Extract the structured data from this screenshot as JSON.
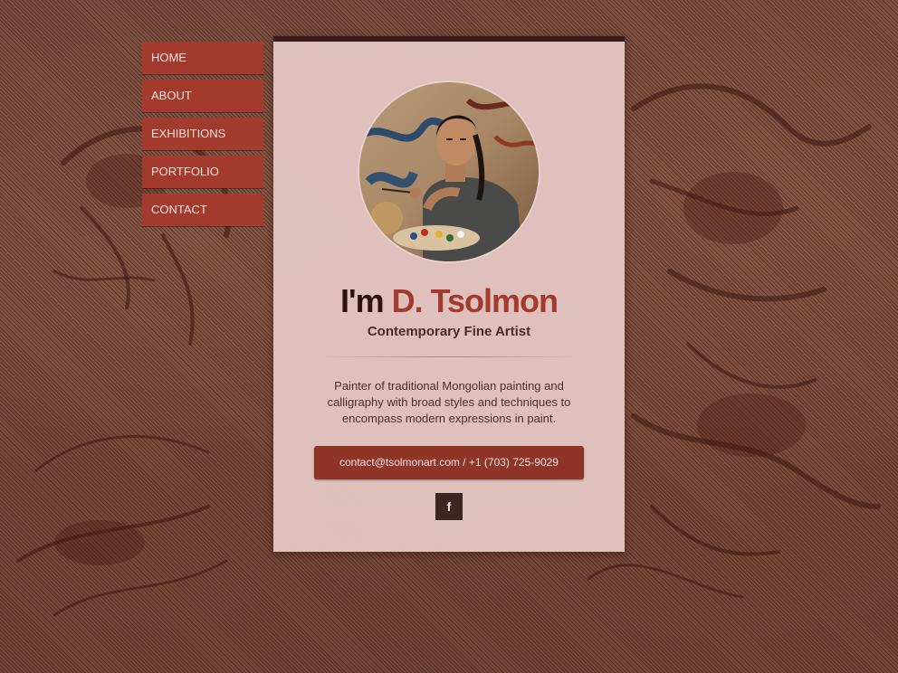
{
  "nav": {
    "items": [
      {
        "label": "HOME"
      },
      {
        "label": "ABOUT"
      },
      {
        "label": "EXHIBITIONS"
      },
      {
        "label": "PORTFOLIO"
      },
      {
        "label": "CONTACT"
      }
    ]
  },
  "profile": {
    "greeting": "I'm",
    "name": "D. Tsolmon",
    "subtitle": "Contemporary Fine Artist",
    "bio": "Painter of traditional Mongolian painting and calligraphy with broad styles and techniques to encompass modern expressions in paint.",
    "contact": "contact@tsolmonart.com / +1 (703) 725-9029",
    "facebook_glyph": "f",
    "avatar": "artist-portrait-photo"
  },
  "colors": {
    "accent": "#a23a2d",
    "button": "#8f3428",
    "card": "#e2c4c0",
    "dark": "#3a1d18"
  },
  "icons": {
    "social": "facebook-icon"
  }
}
